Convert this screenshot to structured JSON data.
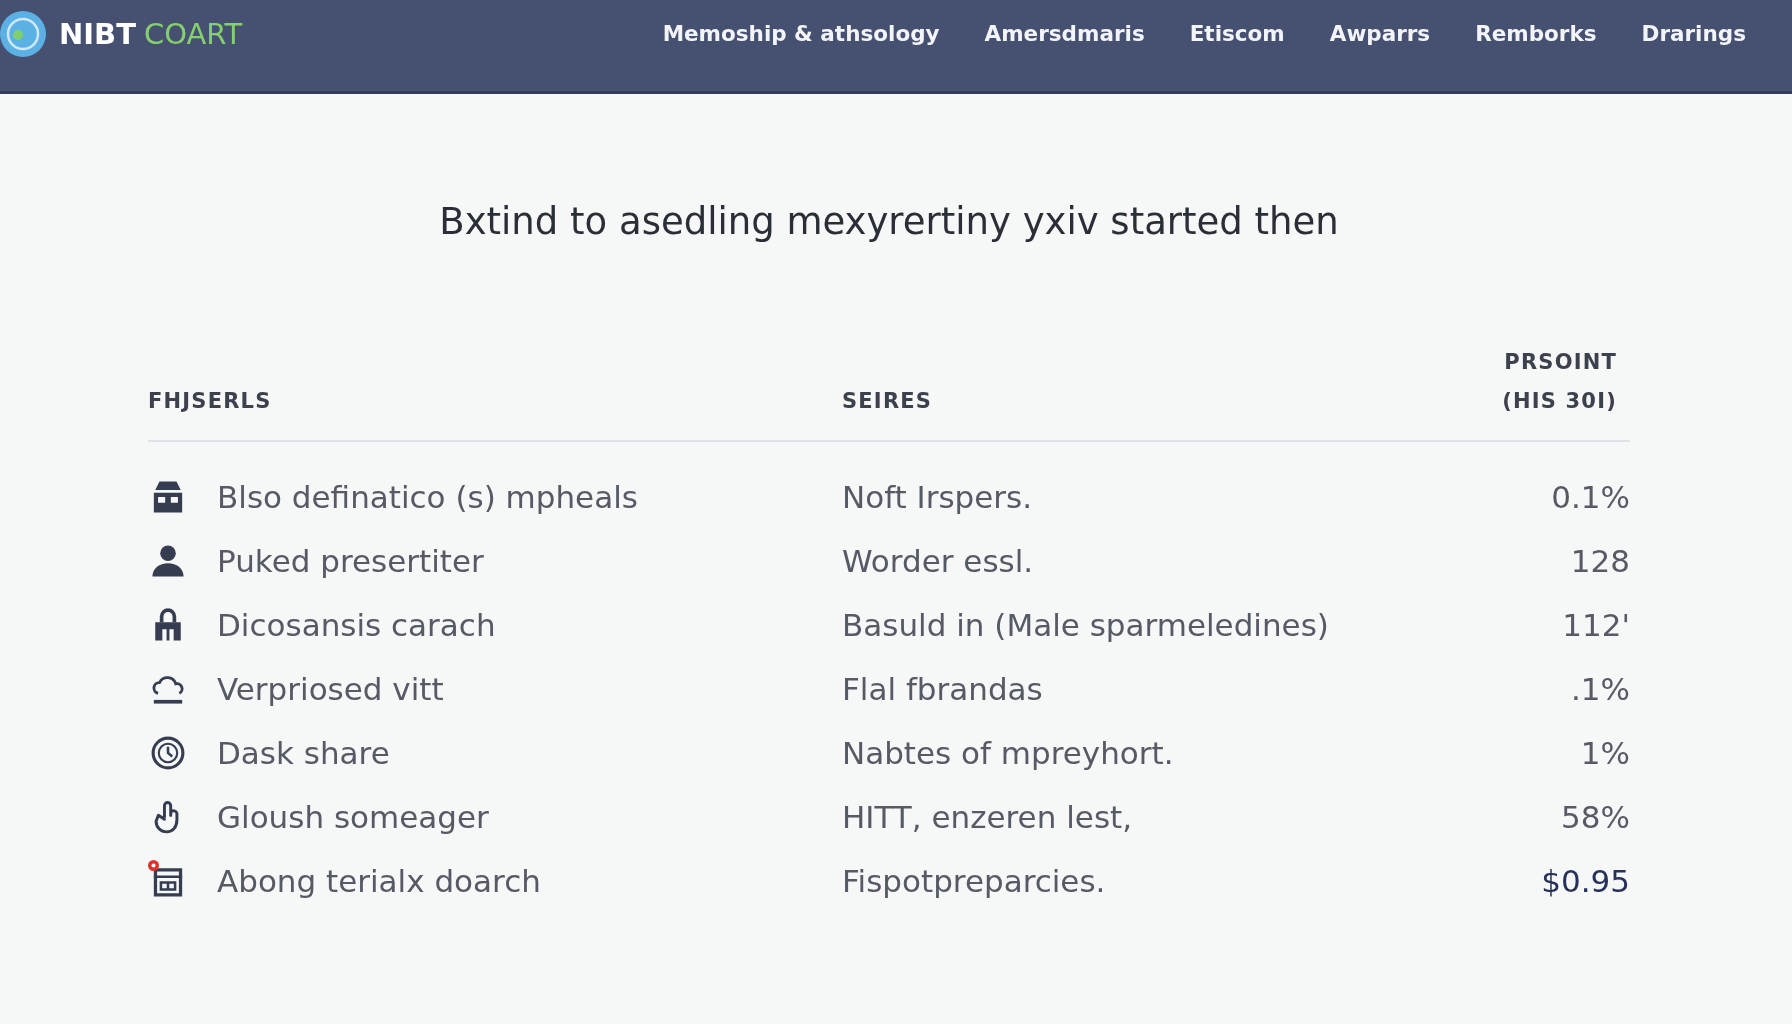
{
  "header": {
    "brand": {
      "primary": "NIBT",
      "secondary": "COART"
    },
    "nav": [
      {
        "label": "Memoship & athsology"
      },
      {
        "label": "Amersdmaris"
      },
      {
        "label": "Etiscom"
      },
      {
        "label": "Awparrs"
      },
      {
        "label": "Remborks"
      },
      {
        "label": "Drarings"
      }
    ]
  },
  "headline": "Bxtind to asedling mexyrertiny yxiv started then",
  "table": {
    "columns": [
      {
        "label": "FHJSERLS"
      },
      {
        "label": "SEIRES"
      },
      {
        "label": "PRSOINT (HIS 30I)"
      }
    ],
    "rows": [
      {
        "name": "Blso definatico (s) mpheals",
        "series": "Noft Irspers.",
        "value": "0.1%",
        "alert": false,
        "emphasized": false
      },
      {
        "name": "Puked presertiter",
        "series": "Worder essl.",
        "value": "128",
        "alert": false,
        "emphasized": false
      },
      {
        "name": "Dicosansis carach",
        "series": "Basuld in (Male sparmeledines)",
        "value": "112'",
        "alert": false,
        "emphasized": false
      },
      {
        "name": "Verpriosed vitt",
        "series": "Flal fbrandas",
        "value": ".1%",
        "alert": false,
        "emphasized": false
      },
      {
        "name": "Dask share",
        "series": "Nabtes of mpreyhort.",
        "value": "1%",
        "alert": false,
        "emphasized": false
      },
      {
        "name": "Gloush someager",
        "series": "HITT, enzeren lest,",
        "value": "58%",
        "alert": false,
        "emphasized": false
      },
      {
        "name": "Abong terialx doarch",
        "series": "Fispotpreparcies.",
        "value": "$0.95",
        "alert": true,
        "emphasized": true
      }
    ]
  }
}
